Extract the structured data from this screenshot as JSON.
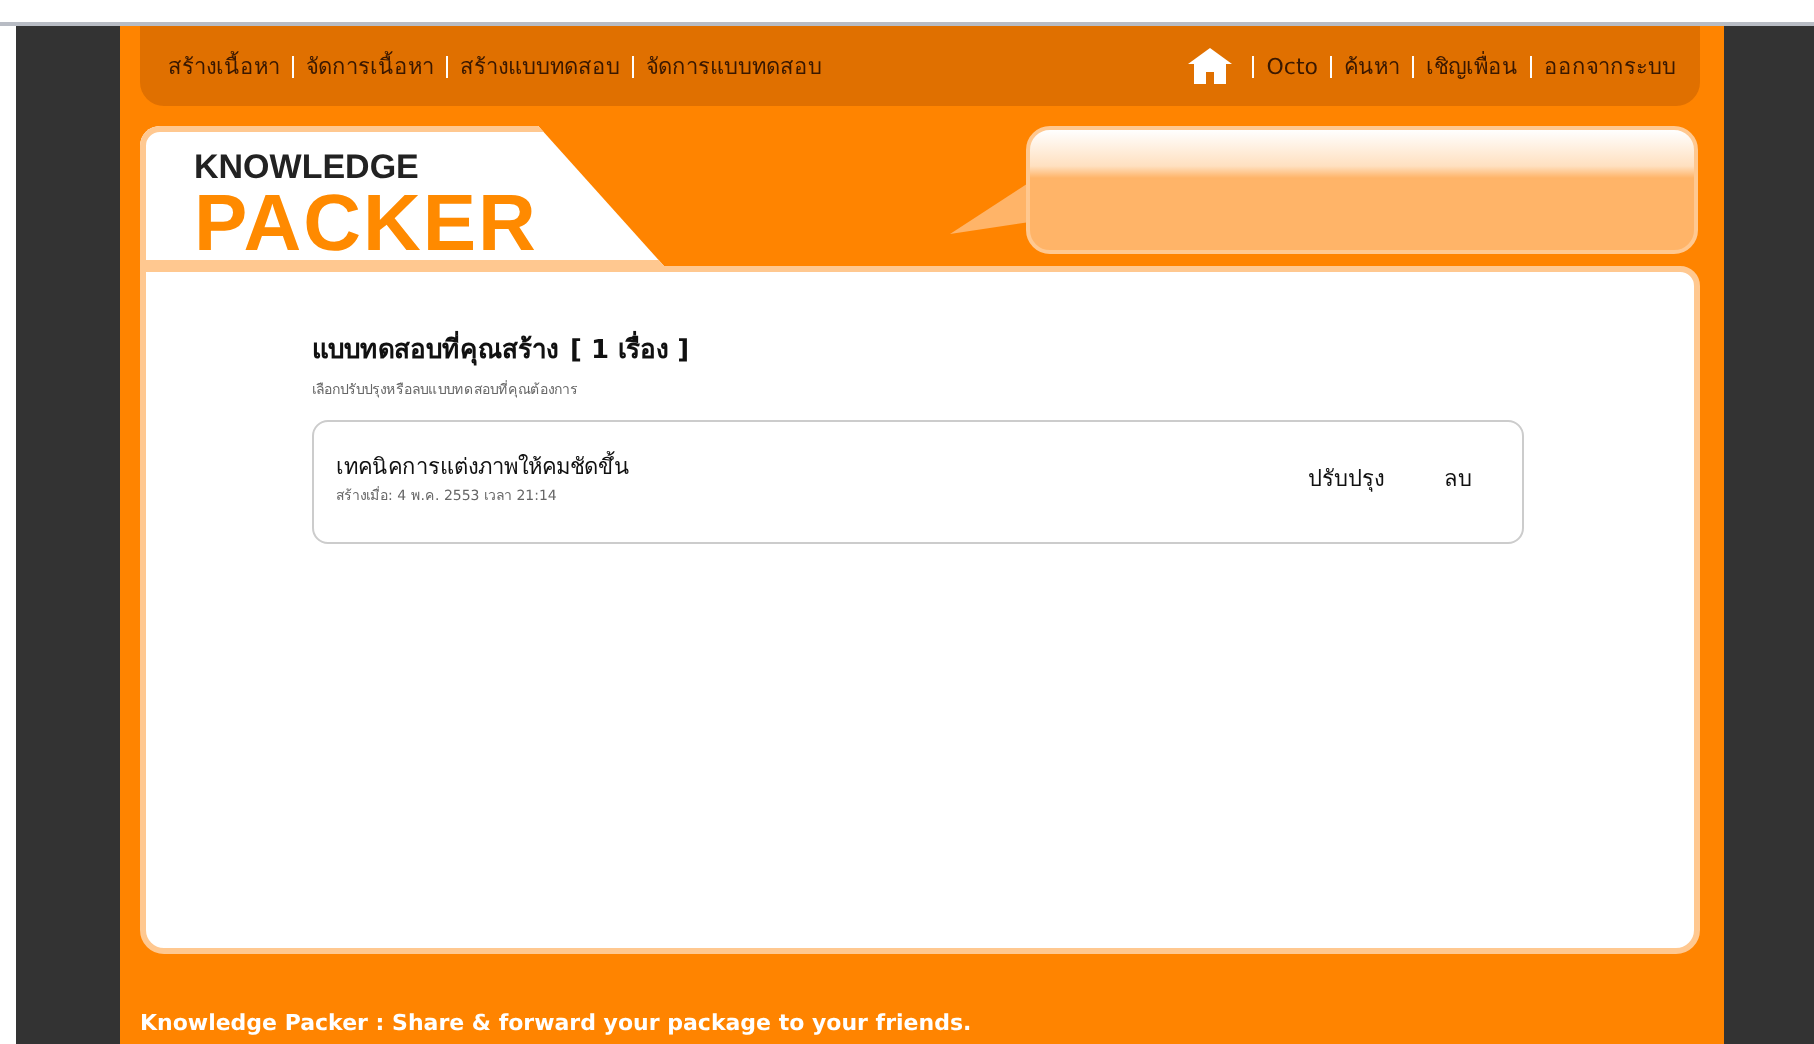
{
  "nav_left": [
    {
      "label": "สร้างเนื้อหา"
    },
    {
      "label": "จัดการเนื้อหา"
    },
    {
      "label": "สร้างแบบทดสอบ"
    },
    {
      "label": "จัดการแบบทดสอบ"
    }
  ],
  "nav_right": [
    {
      "label": "Octo"
    },
    {
      "label": "ค้นหา"
    },
    {
      "label": "เชิญเพื่อน"
    },
    {
      "label": "ออกจากระบบ"
    }
  ],
  "logo": {
    "line_1": "KNOWLEDGE",
    "line_2": "PACKER"
  },
  "section": {
    "title": "แบบทดสอบที่คุณสร้าง",
    "count": "[ 1 เรื่อง ]",
    "subtitle": "เลือกปรับปรุงหรือลบแบบทดสอบที่คุณต้องการ"
  },
  "quizzes": [
    {
      "title": "เทคนิคการแต่งภาพให้คมชัดขึ้น",
      "created": "สร้างเมื่อ: 4 พ.ค. 2553 เวลา 21:14",
      "actions": [
        "ปรับปรุง",
        "ลบ"
      ]
    }
  ],
  "footer": "Knowledge Packer : Share & forward your package to your friends."
}
